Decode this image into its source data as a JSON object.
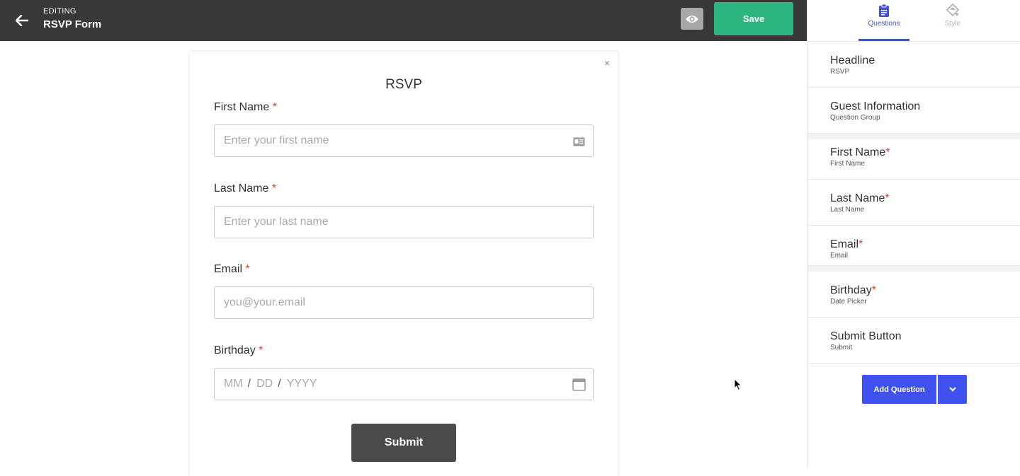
{
  "header": {
    "editing_label": "EDITING",
    "form_title": "RSVP Form",
    "save_label": "Save"
  },
  "form": {
    "title": "RSVP",
    "close": "×",
    "fields": [
      {
        "label": "First Name",
        "required": "*",
        "placeholder": "Enter your first name"
      },
      {
        "label": "Last Name",
        "required": "*",
        "placeholder": "Enter your last name"
      },
      {
        "label": "Email",
        "required": "*",
        "placeholder": "you@your.email"
      },
      {
        "label": "Birthday",
        "required": "*",
        "date_mm": "MM",
        "date_dd": "DD",
        "date_yyyy": "YYYY",
        "separator": "/"
      }
    ],
    "submit_label": "Submit"
  },
  "sidebar": {
    "tabs": [
      {
        "label": "Questions",
        "icon": "clipboard-icon",
        "active": true
      },
      {
        "label": "Style",
        "icon": "paint-icon",
        "active": false
      }
    ],
    "items": [
      {
        "title": "Headline",
        "required": "",
        "sub": "RSVP"
      },
      {
        "title": "Guest Information",
        "required": "",
        "sub": "Question Group"
      },
      {
        "title": "First Name",
        "required": "*",
        "sub": "First Name"
      },
      {
        "title": "Last Name",
        "required": "*",
        "sub": "Last Name"
      },
      {
        "title": "Email",
        "required": "*",
        "sub": "Email"
      },
      {
        "title": "Birthday",
        "required": "*",
        "sub": "Date Picker"
      },
      {
        "title": "Submit Button",
        "required": "",
        "sub": "Submit"
      }
    ],
    "add_question_label": "Add Question"
  },
  "colors": {
    "topbar": "#383838",
    "save": "#2db57e",
    "accent": "#3f51ee",
    "required": "#e0413b"
  }
}
